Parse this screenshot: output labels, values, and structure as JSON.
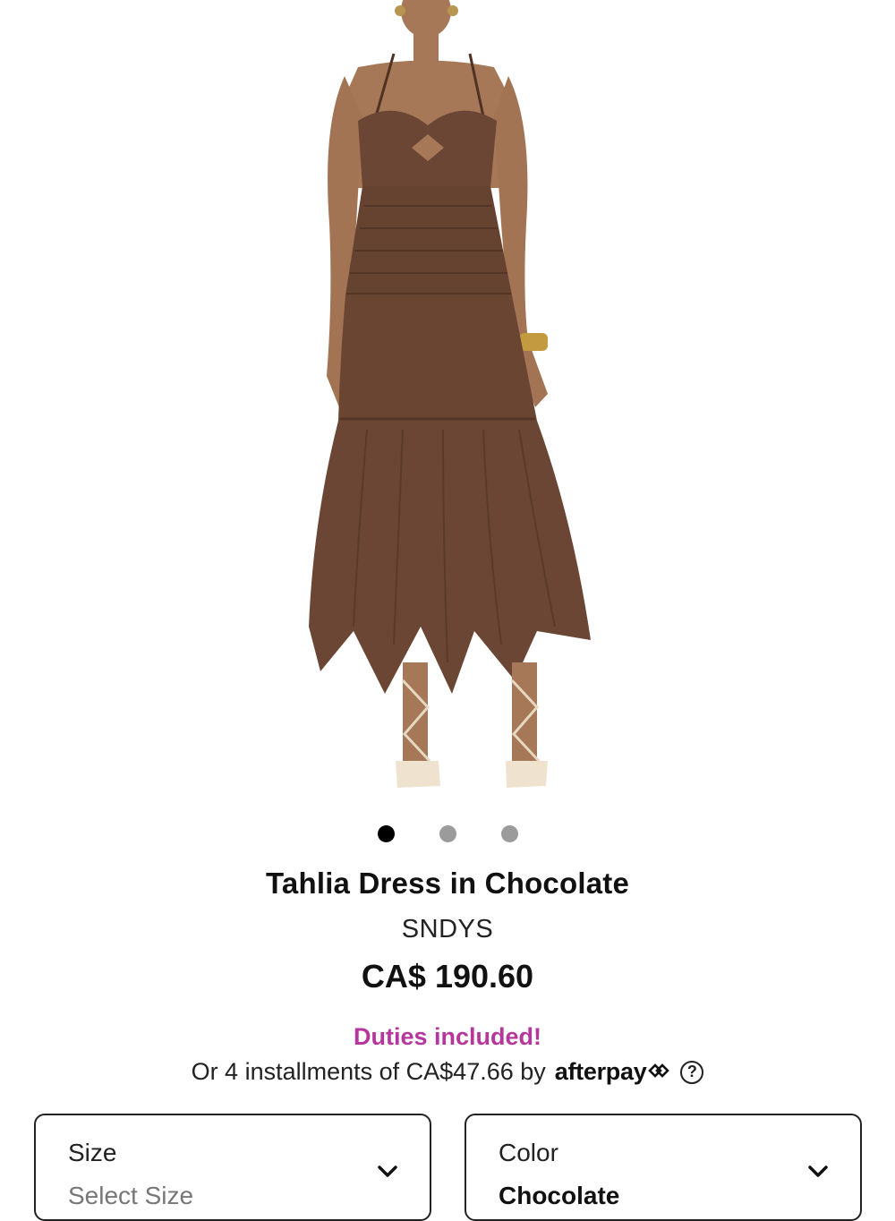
{
  "product": {
    "title": "Tahlia Dress in Chocolate",
    "brand": "SNDYS",
    "price": "CA$ 190.60",
    "duties_note": "Duties included!",
    "installments_text": "Or 4 installments of CA$47.66 by",
    "afterpay_label": "afterpay",
    "help_symbol": "?"
  },
  "gallery": {
    "image_count": 3,
    "active_index": 0
  },
  "options": {
    "size": {
      "label": "Size",
      "value": "Select Size"
    },
    "color": {
      "label": "Color",
      "value": "Chocolate"
    }
  },
  "colors": {
    "dress": "#6b4634",
    "accent": "#b5379c"
  }
}
